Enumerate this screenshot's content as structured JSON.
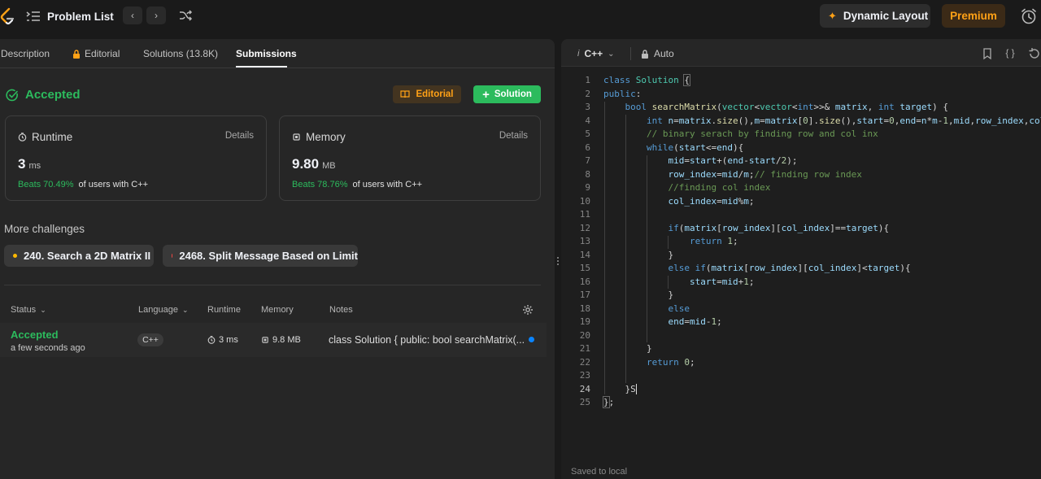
{
  "topbar": {
    "problem_list": "Problem List",
    "dynamic_layout": "Dynamic Layout",
    "premium": "Premium"
  },
  "tabs": [
    "Description",
    "Editorial",
    "Solutions (13.8K)",
    "Submissions"
  ],
  "result": {
    "status": "Accepted",
    "editorial_btn": "Editorial",
    "solution_btn": "Solution"
  },
  "runtime": {
    "title": "Runtime",
    "details": "Details",
    "value": "3",
    "unit": "ms",
    "beats": "Beats 70.49%",
    "suffix": "of users with C++"
  },
  "memory": {
    "title": "Memory",
    "details": "Details",
    "value": "9.80",
    "unit": "MB",
    "beats": "Beats 78.76%",
    "suffix": "of users with C++"
  },
  "challenges": {
    "title": "More challenges",
    "items": [
      {
        "label": "240. Search a 2D Matrix II",
        "color": "#ffb800"
      },
      {
        "label": "2468. Split Message Based on Limit",
        "color": "#ef4743"
      }
    ]
  },
  "table": {
    "headers": [
      "Status",
      "Language",
      "Runtime",
      "Memory",
      "Notes"
    ],
    "row": {
      "status": "Accepted",
      "time": "a few seconds ago",
      "language": "C++",
      "runtime": "3 ms",
      "memory": "9.8 MB",
      "notes": "class Solution { public: bool searchMatrix(..."
    }
  },
  "editor": {
    "language": "C++",
    "mode": "Auto",
    "saved": "Saved to local",
    "line_numbers": [
      "1",
      "2",
      "3",
      "4",
      "5",
      "6",
      "7",
      "8",
      "9",
      "10",
      "11",
      "12",
      "13",
      "14",
      "15",
      "16",
      "17",
      "18",
      "19",
      "20",
      "21",
      "22",
      "23",
      "24",
      "25"
    ]
  },
  "colors": {
    "accent_green": "#2cbb5d",
    "accent_orange": "#ffa116"
  }
}
